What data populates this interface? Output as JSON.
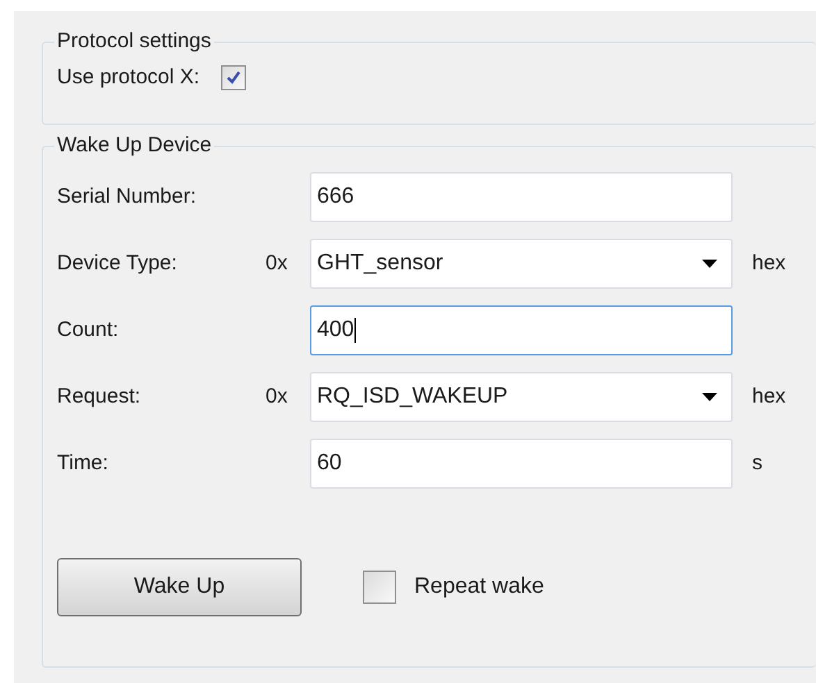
{
  "protocol_group": {
    "title": "Protocol settings",
    "label": "Use protocol X:",
    "checked": true
  },
  "wake_group": {
    "title": "Wake Up Device",
    "fields": [
      {
        "kind": "text",
        "label": "Serial Number:",
        "value": "666",
        "focused": false
      },
      {
        "kind": "combo",
        "label": "Device Type:",
        "prefix": "0x",
        "value": "GHT_sensor",
        "suffix": "hex",
        "focused": false
      },
      {
        "kind": "text",
        "label": "Count:",
        "value": "400",
        "focused": true
      },
      {
        "kind": "combo",
        "label": "Request:",
        "prefix": "0x",
        "value": "RQ_ISD_WAKEUP",
        "suffix": "hex",
        "focused": false
      },
      {
        "kind": "text",
        "label": "Time:",
        "value": "60",
        "suffix": "s",
        "focused": false
      }
    ],
    "button": "Wake Up",
    "repeat": {
      "label": "Repeat wake",
      "checked": false
    }
  }
}
